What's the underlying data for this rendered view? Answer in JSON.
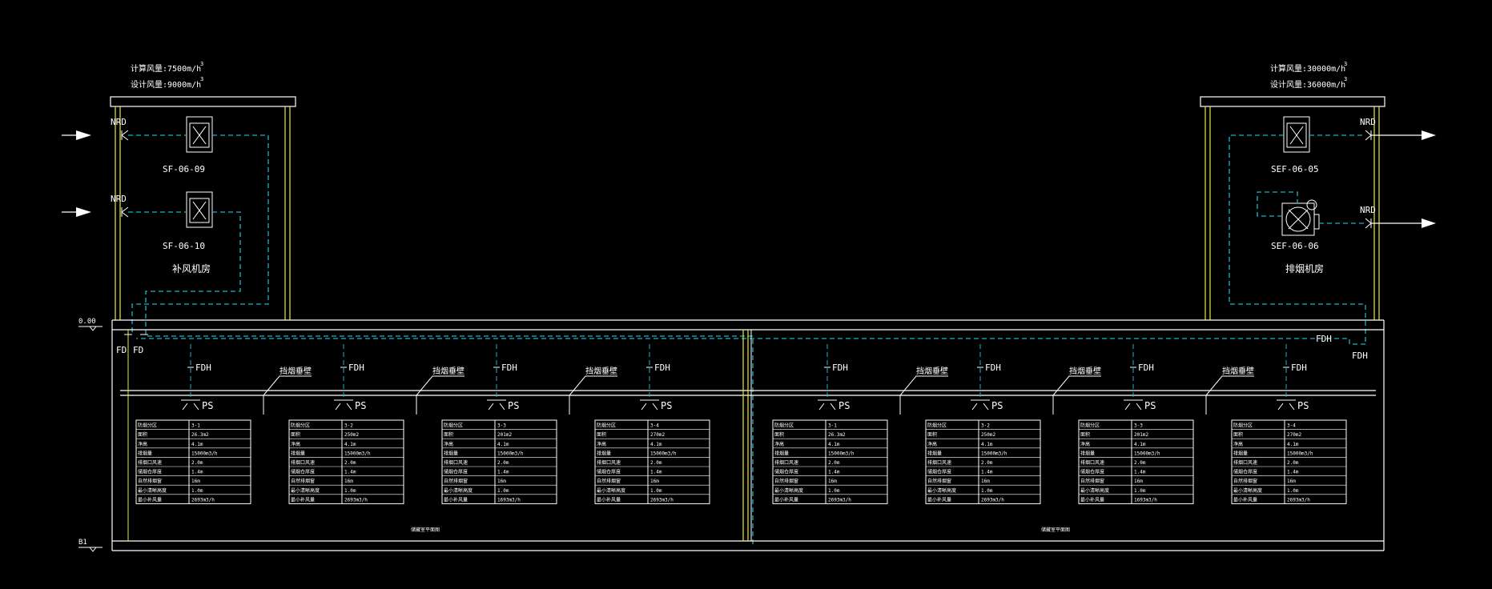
{
  "colors": {
    "bg": "#000000",
    "line": "#ffffff",
    "duct": "#18b4c4",
    "wall": "#e8e838"
  },
  "left_room": {
    "calc_airflow": "计算风量:7500m/h",
    "design_airflow": "设计风量:9000m/h",
    "sup3": "3",
    "fans": [
      {
        "id": "SF-06-09"
      },
      {
        "id": "SF-06-10"
      }
    ],
    "room_name": "补风机房",
    "valve_label": "NRD"
  },
  "right_room": {
    "calc_airflow": "计算风量:30000m/h",
    "design_airflow": "设计风量:36000m/h",
    "sup3": "3",
    "fans": [
      {
        "id": "SEF-06-05"
      },
      {
        "id": "SEF-06-06"
      }
    ],
    "room_name": "排烟机房",
    "valve_label": "NRD"
  },
  "levels": {
    "top": "0.00",
    "bottom": "B1"
  },
  "labels": {
    "fd": "FD",
    "fdh": "FDH",
    "ps": "PS",
    "screen": "挡烟垂壁",
    "section_note": "储藏室平面图"
  },
  "table_rows": [
    "防烟分区",
    "面积",
    "净高",
    "排烟量",
    "排烟口风速",
    "储烟仓厚度",
    "自然排烟窗",
    "最小清晰高度",
    "最小补风量"
  ],
  "zones": [
    {
      "values": [
        "3-1",
        "26.3m2",
        "4.1m",
        "15000m3/h",
        "2.0m",
        "1.4m",
        "16m",
        "1.0m",
        "2693m3/h"
      ]
    },
    {
      "values": [
        "3-2",
        "250m2",
        "4.1m",
        "15000m3/h",
        "2.0m",
        "1.4m",
        "16m",
        "1.0m",
        "2693m3/h"
      ]
    },
    {
      "values": [
        "3-3",
        "201m2",
        "4.1m",
        "15000m3/h",
        "2.0m",
        "1.4m",
        "16m",
        "1.0m",
        "1693m3/h"
      ]
    },
    {
      "values": [
        "3-4",
        "270m2",
        "4.1m",
        "15000m3/h",
        "2.0m",
        "1.4m",
        "16m",
        "1.0m",
        "2693m3/h"
      ]
    },
    {
      "values": [
        "3-1",
        "26.3m2",
        "4.1m",
        "15000m3/h",
        "2.0m",
        "1.4m",
        "16m",
        "1.0m",
        "2693m3/h"
      ]
    },
    {
      "values": [
        "3-2",
        "250m2",
        "4.1m",
        "15000m3/h",
        "2.0m",
        "1.4m",
        "16m",
        "1.0m",
        "2693m3/h"
      ]
    },
    {
      "values": [
        "3-3",
        "201m2",
        "4.1m",
        "15000m3/h",
        "2.0m",
        "1.4m",
        "16m",
        "1.0m",
        "1693m3/h"
      ]
    },
    {
      "values": [
        "3-4",
        "270m2",
        "4.1m",
        "15000m3/h",
        "2.0m",
        "1.4m",
        "16m",
        "1.0m",
        "2693m3/h"
      ]
    }
  ]
}
